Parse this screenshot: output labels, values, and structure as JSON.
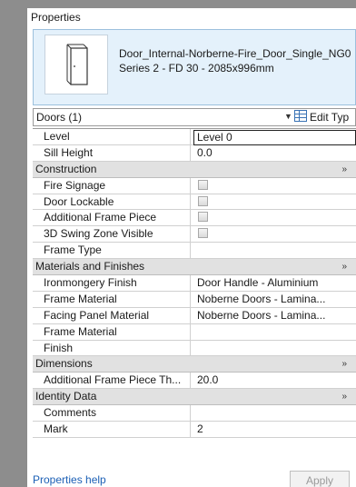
{
  "panel": {
    "title": "Properties"
  },
  "type_selector": {
    "name_line1": "Door_Internal-Norberne-Fire_Door_Single_NG0",
    "name_line2": "Series 2 - FD 30 - 2085x996mm"
  },
  "instance_selector": {
    "value": "Doors (1)",
    "edit_type_label": "Edit Typ"
  },
  "rows": {
    "level": {
      "name": "Level",
      "value": "Level 0"
    },
    "sill_height": {
      "name": "Sill Height",
      "value": "0.0"
    },
    "construction": {
      "label": "Construction"
    },
    "fire_signage": {
      "name": "Fire Signage"
    },
    "door_lockable": {
      "name": "Door Lockable"
    },
    "additional_frame_piece": {
      "name": "Additional Frame Piece"
    },
    "swing_zone": {
      "name": "3D Swing Zone Visible"
    },
    "frame_type": {
      "name": "Frame Type",
      "value": ""
    },
    "materials": {
      "label": "Materials and Finishes"
    },
    "ironmongery": {
      "name": "Ironmongery Finish",
      "value": "Door Handle - Aluminium"
    },
    "frame_material": {
      "name": "Frame Material",
      "value": "Noberne Doors - Lamina..."
    },
    "facing_panel": {
      "name": "Facing Panel Material",
      "value": "Noberne Doors - Lamina..."
    },
    "frame_material_2": {
      "name": "Frame Material",
      "value": ""
    },
    "finish": {
      "name": "Finish",
      "value": ""
    },
    "dimensions": {
      "label": "Dimensions"
    },
    "frame_piece_th": {
      "name": "Additional Frame Piece Th...",
      "value": "20.0"
    },
    "identity": {
      "label": "Identity Data"
    },
    "comments": {
      "name": "Comments",
      "value": ""
    },
    "mark": {
      "name": "Mark",
      "value": "2"
    }
  },
  "group_collapse_glyph": "»",
  "footer": {
    "help_label": "Properties help",
    "apply_label": "Apply"
  },
  "icons": {
    "dropdown": "dropdown-arrow-icon",
    "edit_type": "edit-type-icon",
    "collapse": "collapse-chevron-icon",
    "door": "door-thumbnail-icon"
  },
  "colors": {
    "header_bg": "#e4f1fb",
    "group_bg": "#e1e1e1",
    "link": "#1b5fb5"
  }
}
